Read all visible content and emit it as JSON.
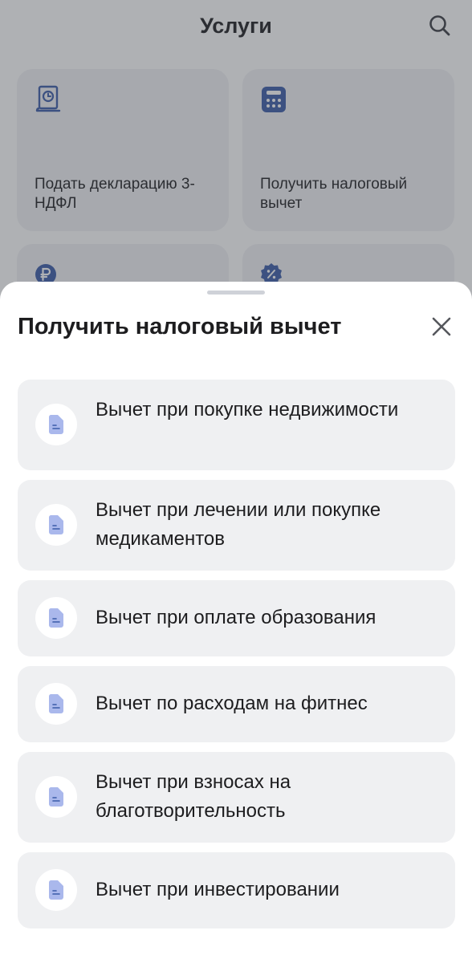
{
  "header": {
    "title": "Услуги"
  },
  "tiles": [
    {
      "label": "Подать декларацию 3-НДФЛ",
      "icon": "tax-declaration-icon"
    },
    {
      "label": "Получить налоговый вычет",
      "icon": "calculator-icon"
    },
    {
      "label": "",
      "icon": "ruble-coin-icon"
    },
    {
      "label": "",
      "icon": "percent-badge-icon"
    }
  ],
  "sheet": {
    "title": "Получить налоговый вычет",
    "items": [
      {
        "label": "Вычет при покупке недвижимости",
        "icon": "document-icon"
      },
      {
        "label": "Вычет при лечении или покупке медикаментов",
        "icon": "document-icon"
      },
      {
        "label": "Вычет при оплате образования",
        "icon": "document-icon"
      },
      {
        "label": "Вычет по расходам на фитнес",
        "icon": "document-icon"
      },
      {
        "label": "Вычет при взносах на благотворительность",
        "icon": "document-icon"
      },
      {
        "label": "Вычет при инвестировании",
        "icon": "document-icon"
      }
    ]
  },
  "colors": {
    "accent": "#3a5aa8",
    "icon_fill": "#aab8ec",
    "card_bg": "#eff0f2",
    "overlay": "#8b8d92"
  }
}
